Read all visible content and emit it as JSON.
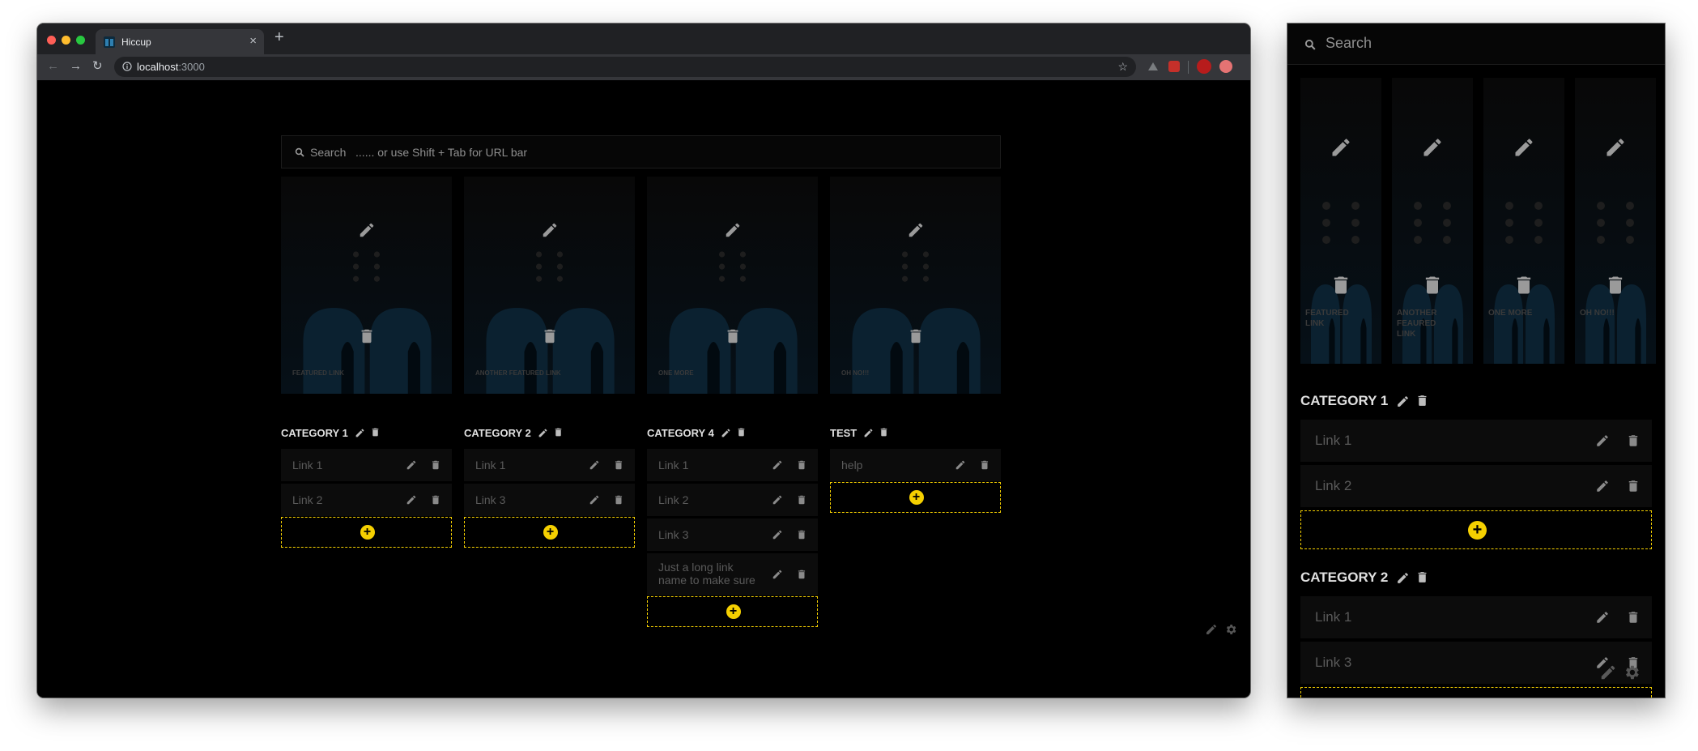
{
  "browser": {
    "tab_title": "Hiccup",
    "url_host": "localhost",
    "url_port": ":3000"
  },
  "search": {
    "desktop_label": "Search",
    "desktop_hint": "...... or use Shift + Tab for URL bar",
    "mobile_label": "Search"
  },
  "desktop": {
    "featured": [
      {
        "caption": "FEATURED LINK"
      },
      {
        "caption": "ANOTHER FEATURED LINK"
      },
      {
        "caption": "ONE MORE"
      },
      {
        "caption": "OH NO!!!"
      }
    ],
    "categories": [
      {
        "name": "CATEGORY 1",
        "links": [
          "Link 1",
          "Link 2"
        ]
      },
      {
        "name": "CATEGORY 2",
        "links": [
          "Link 1",
          "Link 3"
        ]
      },
      {
        "name": "CATEGORY 4",
        "links": [
          "Link 1",
          "Link 2",
          "Link 3",
          "Just a long link name to make sure we are safe"
        ]
      },
      {
        "name": "TEST",
        "links": [
          "help"
        ]
      }
    ]
  },
  "mobile": {
    "featured": [
      {
        "caption": "FEATURED LINK"
      },
      {
        "caption": "ANOTHER FEAURED LINK"
      },
      {
        "caption": "ONE MORE"
      },
      {
        "caption": "OH NO!!!"
      }
    ],
    "categories": [
      {
        "name": "CATEGORY 1",
        "links": [
          "Link 1",
          "Link 2"
        ]
      },
      {
        "name": "CATEGORY 2",
        "links": [
          "Link 1",
          "Link 3"
        ]
      }
    ]
  },
  "colors": {
    "accent": "#f5d000",
    "background": "#000000",
    "link_row": "#0c0c0c",
    "tile_art": "#0b2130"
  },
  "icons": {
    "edit": "pencil-icon",
    "delete": "trash-icon",
    "add": "plus-circle-icon",
    "search": "search-icon",
    "settings": "gear-icon"
  }
}
